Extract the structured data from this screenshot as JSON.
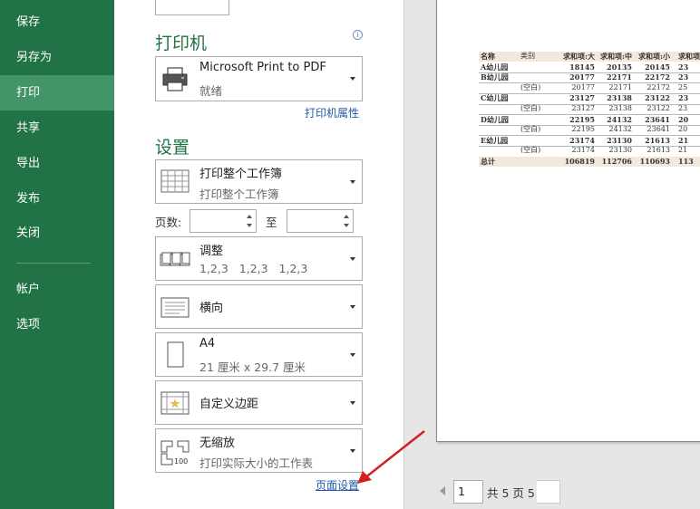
{
  "sidebar": {
    "items": [
      {
        "label": "保存"
      },
      {
        "label": "另存为"
      },
      {
        "label": "打印",
        "active": true
      },
      {
        "label": "共享"
      },
      {
        "label": "导出"
      },
      {
        "label": "发布"
      },
      {
        "label": "关闭"
      },
      {
        "label": "帐户"
      },
      {
        "label": "选项"
      }
    ]
  },
  "printer": {
    "section_title": "打印机",
    "name": "Microsoft Print to PDF",
    "status": "就绪",
    "properties_link": "打印机属性"
  },
  "settings": {
    "section_title": "设置",
    "scope": {
      "title": "打印整个工作簿",
      "subtitle": "打印整个工作簿"
    },
    "pages_label": "页数:",
    "pages_from": "",
    "pages_to_label": "至",
    "pages_to": "",
    "collate": {
      "title": "调整",
      "subtitle": "1,2,3    1,2,3    1,2,3"
    },
    "orientation": {
      "title": "横向"
    },
    "paper": {
      "title": "A4",
      "subtitle": "21 厘米 x 29.7 厘米"
    },
    "margins": {
      "title": "自定义边距"
    },
    "scaling": {
      "title": "无缩放",
      "subtitle": "打印实际大小的工作表"
    },
    "page_setup_link": "页面设置"
  },
  "preview": {
    "table": {
      "headers": [
        "名称",
        "类别",
        "求和项:大",
        "求和项:中",
        "求和项:小",
        "求和项"
      ],
      "rows": [
        [
          "A幼儿园",
          "",
          "18145",
          "20135",
          "20145",
          "23"
        ],
        [
          "B幼儿园",
          "",
          "20177",
          "22171",
          "22172",
          "23"
        ],
        [
          "",
          "(空白)",
          "20177",
          "22171",
          "22172",
          "25"
        ],
        [
          "C幼儿园",
          "",
          "23127",
          "23138",
          "23122",
          "23"
        ],
        [
          "",
          "(空白)",
          "23127",
          "23138",
          "23122",
          "23"
        ],
        [
          "D幼儿园",
          "",
          "22195",
          "24132",
          "23641",
          "20"
        ],
        [
          "",
          "(空白)",
          "22195",
          "24132",
          "23641",
          "20"
        ],
        [
          "E幼儿园",
          "",
          "23174",
          "23130",
          "21613",
          "21"
        ],
        [
          "",
          "(空白)",
          "23174",
          "23130",
          "21613",
          "21"
        ],
        [
          "总计",
          "",
          "106819",
          "112706",
          "110693",
          "113"
        ]
      ]
    },
    "current_page": "1",
    "total_pages_text": "共 5 页 5 1"
  },
  "colors": {
    "sidebar_bg": "#217346",
    "sidebar_active": "#439467",
    "accent_title": "#217346",
    "link": "#1e5aa8",
    "annotation_arrow": "#d0201f"
  }
}
